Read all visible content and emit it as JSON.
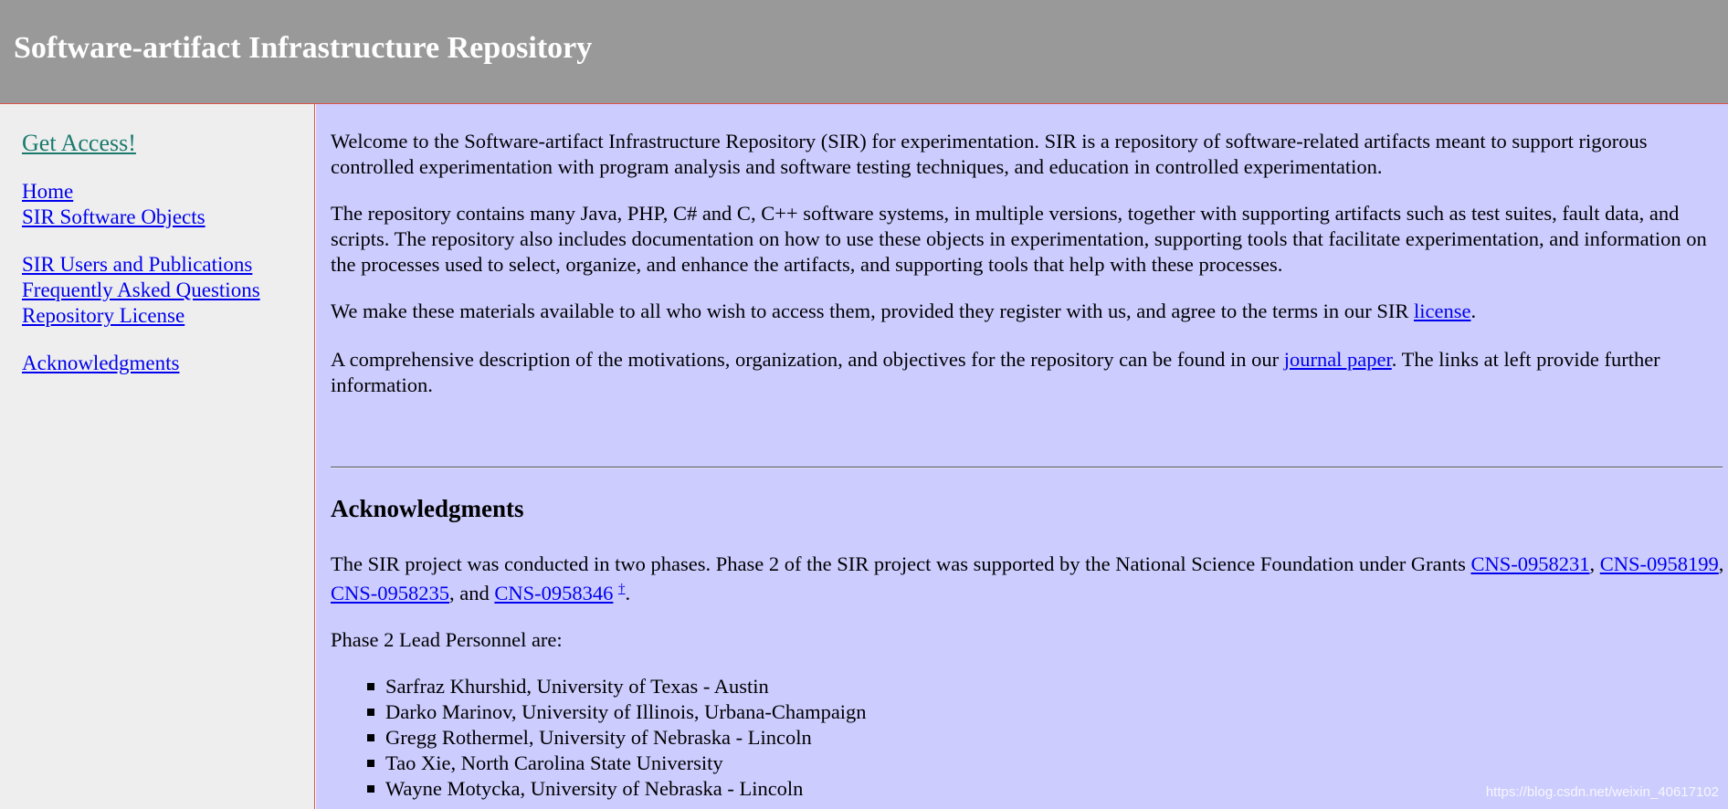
{
  "header": {
    "title": "Software-artifact Infrastructure Repository"
  },
  "sidebar": {
    "access": "Get Access!",
    "items": [
      {
        "label": "Home"
      },
      {
        "label": "SIR Software Objects"
      },
      {
        "label": "SIR Users and Publications"
      },
      {
        "label": "Frequently Asked Questions"
      },
      {
        "label": "Repository License"
      },
      {
        "label": "Acknowledgments"
      }
    ]
  },
  "main": {
    "p1": "Welcome to the Software-artifact Infrastructure Repository (SIR) for experimentation. SIR is a repository of software-related artifacts meant to support rigorous controlled experimentation with program analysis and software testing techniques, and education in controlled experimentation.",
    "p2": "The repository contains many Java, PHP, C# and C, C++ software systems, in multiple versions, together with supporting artifacts such as test suites, fault data, and scripts. The repository also includes documentation on how to use these objects in experimentation, supporting tools that facilitate experimentation, and information on the processes used to select, organize, and enhance the artifacts, and supporting tools that help with these processes.",
    "p3_before": "We make these materials available to all who wish to access them, provided they register with us, and agree to the terms in our SIR ",
    "p3_link": "license",
    "p3_after": ".",
    "p4_before": "A comprehensive description of the motivations, organization, and objectives for the repository can be found in our ",
    "p4_link": "journal paper",
    "p4_after": ". The links at left provide further information.",
    "ack_heading": "Acknowledgments",
    "ack_before": "The SIR project was conducted in two phases. Phase 2 of the SIR project was supported by the National Science Foundation under Grants ",
    "grants": [
      "CNS-0958231",
      "CNS-0958199",
      "CNS-0958235",
      "CNS-0958346"
    ],
    "sep_comma": ", ",
    "sep_and": ", and ",
    "dagger": "†",
    "ack_end": ".",
    "personnel_label": "Phase 2 Lead Personnel are:",
    "personnel": [
      "Sarfraz Khurshid, University of Texas - Austin",
      "Darko Marinov, University of Illinois, Urbana-Champaign",
      "Gregg Rothermel, University of Nebraska - Lincoln",
      "Tao Xie, North Carolina State University",
      "Wayne Motycka, University of Nebraska - Lincoln"
    ]
  },
  "watermark": "https://blog.csdn.net/weixin_40617102",
  "colors": {
    "header_bg": "#999999",
    "sidebar_bg": "#eeeeee",
    "main_bg": "#ccccff",
    "link": "#0000ee",
    "access_link": "#1a7a6e",
    "divider": "#d9534f"
  }
}
